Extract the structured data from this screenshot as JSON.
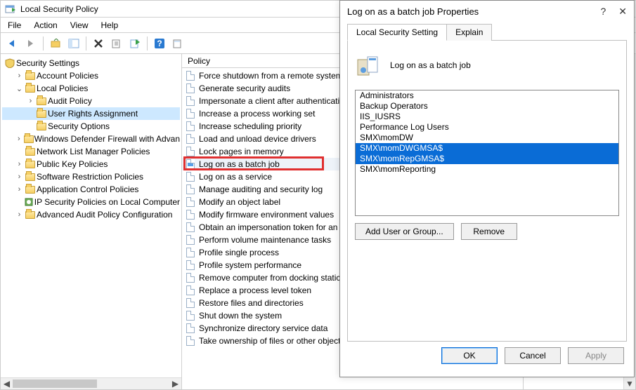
{
  "window": {
    "title": "Local Security Policy",
    "menus": [
      "File",
      "Action",
      "View",
      "Help"
    ]
  },
  "toolbar_icons": [
    "back",
    "forward",
    "up",
    "show-hide-tree",
    "delete",
    "refresh",
    "export",
    "help",
    "properties"
  ],
  "tree": {
    "root": "Security Settings",
    "items": [
      {
        "label": "Account Policies",
        "expandable": true,
        "expanded": false,
        "indent": 1
      },
      {
        "label": "Local Policies",
        "expandable": true,
        "expanded": true,
        "indent": 1
      },
      {
        "label": "Audit Policy",
        "expandable": true,
        "expanded": false,
        "indent": 2
      },
      {
        "label": "User Rights Assignment",
        "expandable": false,
        "expanded": false,
        "indent": 2,
        "selected": true
      },
      {
        "label": "Security Options",
        "expandable": false,
        "expanded": false,
        "indent": 2
      },
      {
        "label": "Windows Defender Firewall with Advan",
        "expandable": true,
        "expanded": false,
        "indent": 1
      },
      {
        "label": "Network List Manager Policies",
        "expandable": false,
        "expanded": false,
        "indent": 1
      },
      {
        "label": "Public Key Policies",
        "expandable": true,
        "expanded": false,
        "indent": 1
      },
      {
        "label": "Software Restriction Policies",
        "expandable": true,
        "expanded": false,
        "indent": 1
      },
      {
        "label": "Application Control Policies",
        "expandable": true,
        "expanded": false,
        "indent": 1
      },
      {
        "label": "IP Security Policies on Local Computer",
        "expandable": false,
        "expanded": false,
        "indent": 1,
        "icon": "shield"
      },
      {
        "label": "Advanced Audit Policy Configuration",
        "expandable": true,
        "expanded": false,
        "indent": 1
      }
    ]
  },
  "list": {
    "header": "Policy",
    "items": [
      "Force shutdown from a remote system",
      "Generate security audits",
      "Impersonate a client after authenticati",
      "Increase a process working set",
      "Increase scheduling priority",
      "Load and unload device drivers",
      "Lock pages in memory",
      "Log on as a batch job",
      "Log on as a service",
      "Manage auditing and security log",
      "Modify an object label",
      "Modify firmware environment values",
      "Obtain an impersonation token for an",
      "Perform volume maintenance tasks",
      "Profile single process",
      "Profile system performance",
      "Remove computer from docking static",
      "Replace a process level token",
      "Restore files and directories",
      "Shut down the system",
      "Synchronize directory service data",
      "Take ownership of files or other objects"
    ],
    "selected_index": 7,
    "highlighted_index": 7
  },
  "details": {
    "label": "Administrators"
  },
  "dialog": {
    "title": "Log on as a batch job Properties",
    "help_icon": "?",
    "close_icon": "✕",
    "tabs": [
      "Local Security Setting",
      "Explain"
    ],
    "active_tab": 0,
    "policy_name": "Log on as a batch job",
    "users": [
      {
        "name": "Administrators",
        "selected": false
      },
      {
        "name": "Backup Operators",
        "selected": false
      },
      {
        "name": "IIS_IUSRS",
        "selected": false
      },
      {
        "name": "Performance Log Users",
        "selected": false
      },
      {
        "name": "SMX\\momDW",
        "selected": false
      },
      {
        "name": "SMX\\momDWGMSA$",
        "selected": true
      },
      {
        "name": "SMX\\momRepGMSA$",
        "selected": true
      },
      {
        "name": "SMX\\momReporting",
        "selected": false
      }
    ],
    "buttons": {
      "add": "Add User or Group...",
      "remove": "Remove",
      "ok": "OK",
      "cancel": "Cancel",
      "apply": "Apply"
    }
  }
}
